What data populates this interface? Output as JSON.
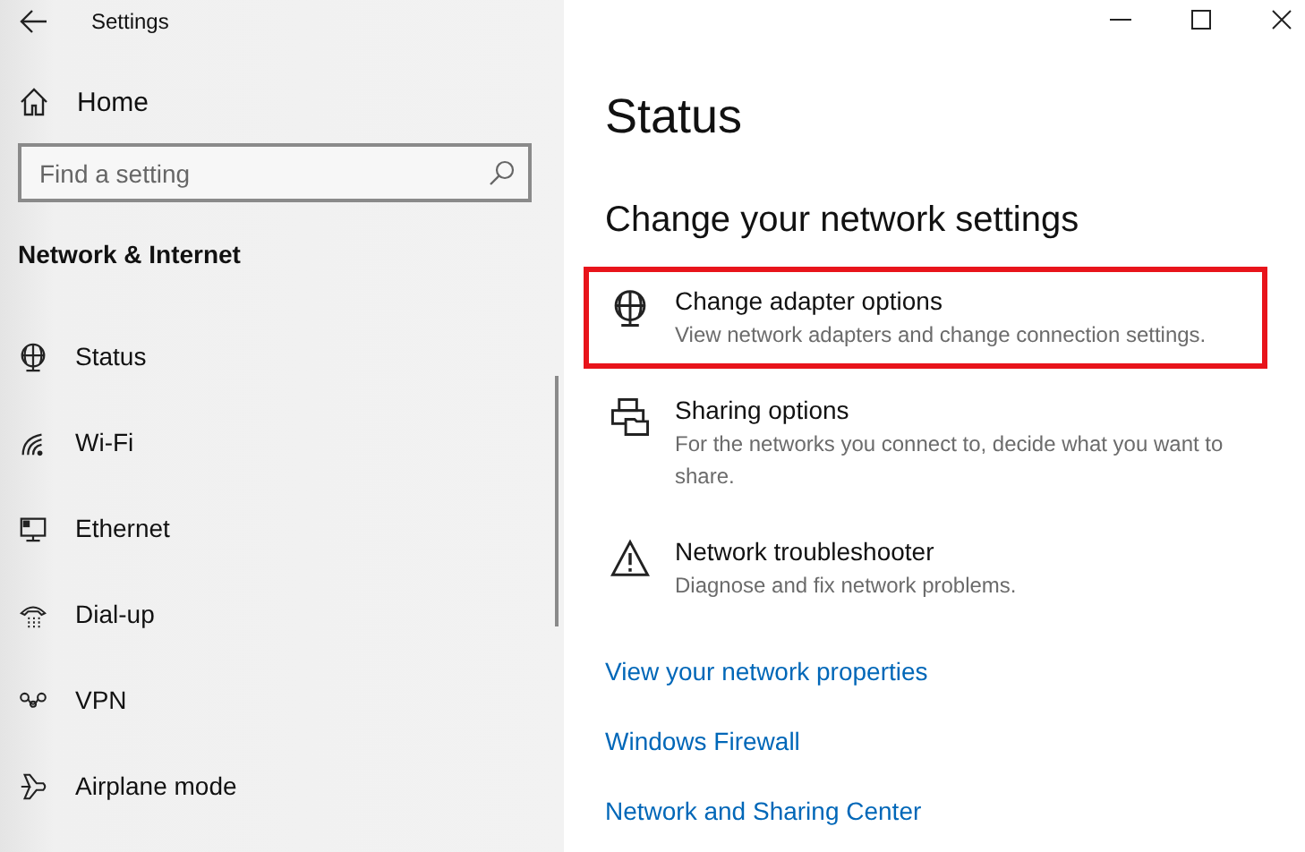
{
  "window": {
    "title": "Settings"
  },
  "sidebar": {
    "home": {
      "label": "Home"
    },
    "search": {
      "placeholder": "Find a setting"
    },
    "section": "Network & Internet",
    "items": [
      {
        "label": "Status"
      },
      {
        "label": "Wi-Fi"
      },
      {
        "label": "Ethernet"
      },
      {
        "label": "Dial-up"
      },
      {
        "label": "VPN"
      },
      {
        "label": "Airplane mode"
      }
    ]
  },
  "main": {
    "title": "Status",
    "subtitle": "Change your network settings",
    "options": [
      {
        "title": "Change adapter options",
        "description": "View network adapters and change connection settings.",
        "highlighted": true
      },
      {
        "title": "Sharing options",
        "description": "For the networks you connect to, decide what you want to share.",
        "highlighted": false
      },
      {
        "title": "Network troubleshooter",
        "description": "Diagnose and fix network problems.",
        "highlighted": false
      }
    ],
    "links": [
      "View your network properties",
      "Windows Firewall",
      "Network and Sharing Center"
    ]
  }
}
